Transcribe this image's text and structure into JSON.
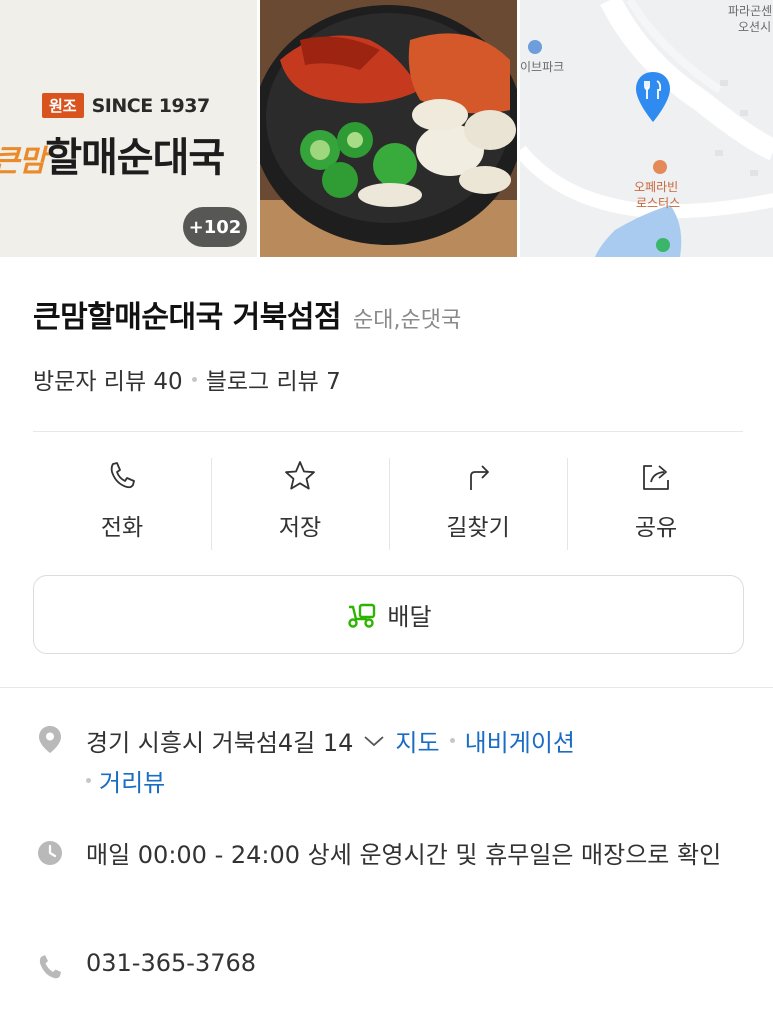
{
  "photos": {
    "sign_origin": "원조",
    "sign_since": "SINCE 1937",
    "sign_name_prefix": "큰맘",
    "sign_name_main": "할매순대국",
    "more_count": "+102",
    "map_labels": [
      "파라곤센",
      "오션시",
      "이브파크",
      "오페라빈",
      "로스터스"
    ]
  },
  "place": {
    "title": "큰맘할매순대국 거북섬점",
    "category": "순대,순댓국",
    "visitor_reviews": "방문자 리뷰 40",
    "blog_reviews": "블로그 리뷰 7"
  },
  "actions": {
    "call": "전화",
    "save": "저장",
    "directions": "길찾기",
    "share": "공유"
  },
  "delivery": {
    "label": "배달"
  },
  "info": {
    "address": "경기 시흥시 거북섬4길 14",
    "map_link": "지도",
    "navigation_link": "내비게이션",
    "streetview_link": "거리뷰",
    "hours": "매일 00:00 - 24:00 상세 운영시간 및 휴무일은 매장으로 확인",
    "phone": "031-365-3768"
  },
  "colors": {
    "accent_link": "#1b6cc4",
    "delivery_icon": "#2db400",
    "map_pin": "#2f8bf0"
  }
}
